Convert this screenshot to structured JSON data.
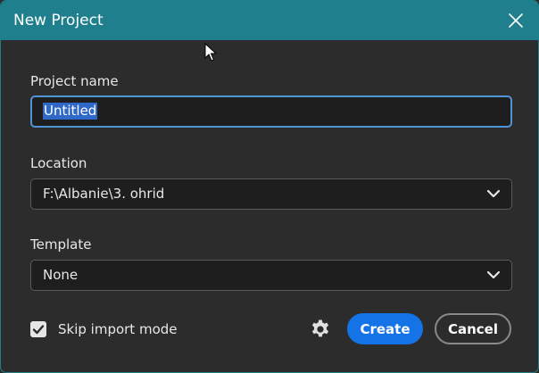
{
  "window": {
    "title": "New Project"
  },
  "form": {
    "project_name": {
      "label": "Project name",
      "value": "Untitled"
    },
    "location": {
      "label": "Location",
      "value": "F:\\Albanie\\3. ohrid"
    },
    "template": {
      "label": "Template",
      "value": "None"
    },
    "skip_import": {
      "label": "Skip import mode",
      "checked": true
    }
  },
  "actions": {
    "create_label": "Create",
    "cancel_label": "Cancel"
  },
  "colors": {
    "title_bar": "#1f7f8c",
    "background": "#2c2c2c",
    "primary_button": "#1473e6",
    "input_focus": "#4f94d4",
    "selection": "#2f68c8"
  }
}
